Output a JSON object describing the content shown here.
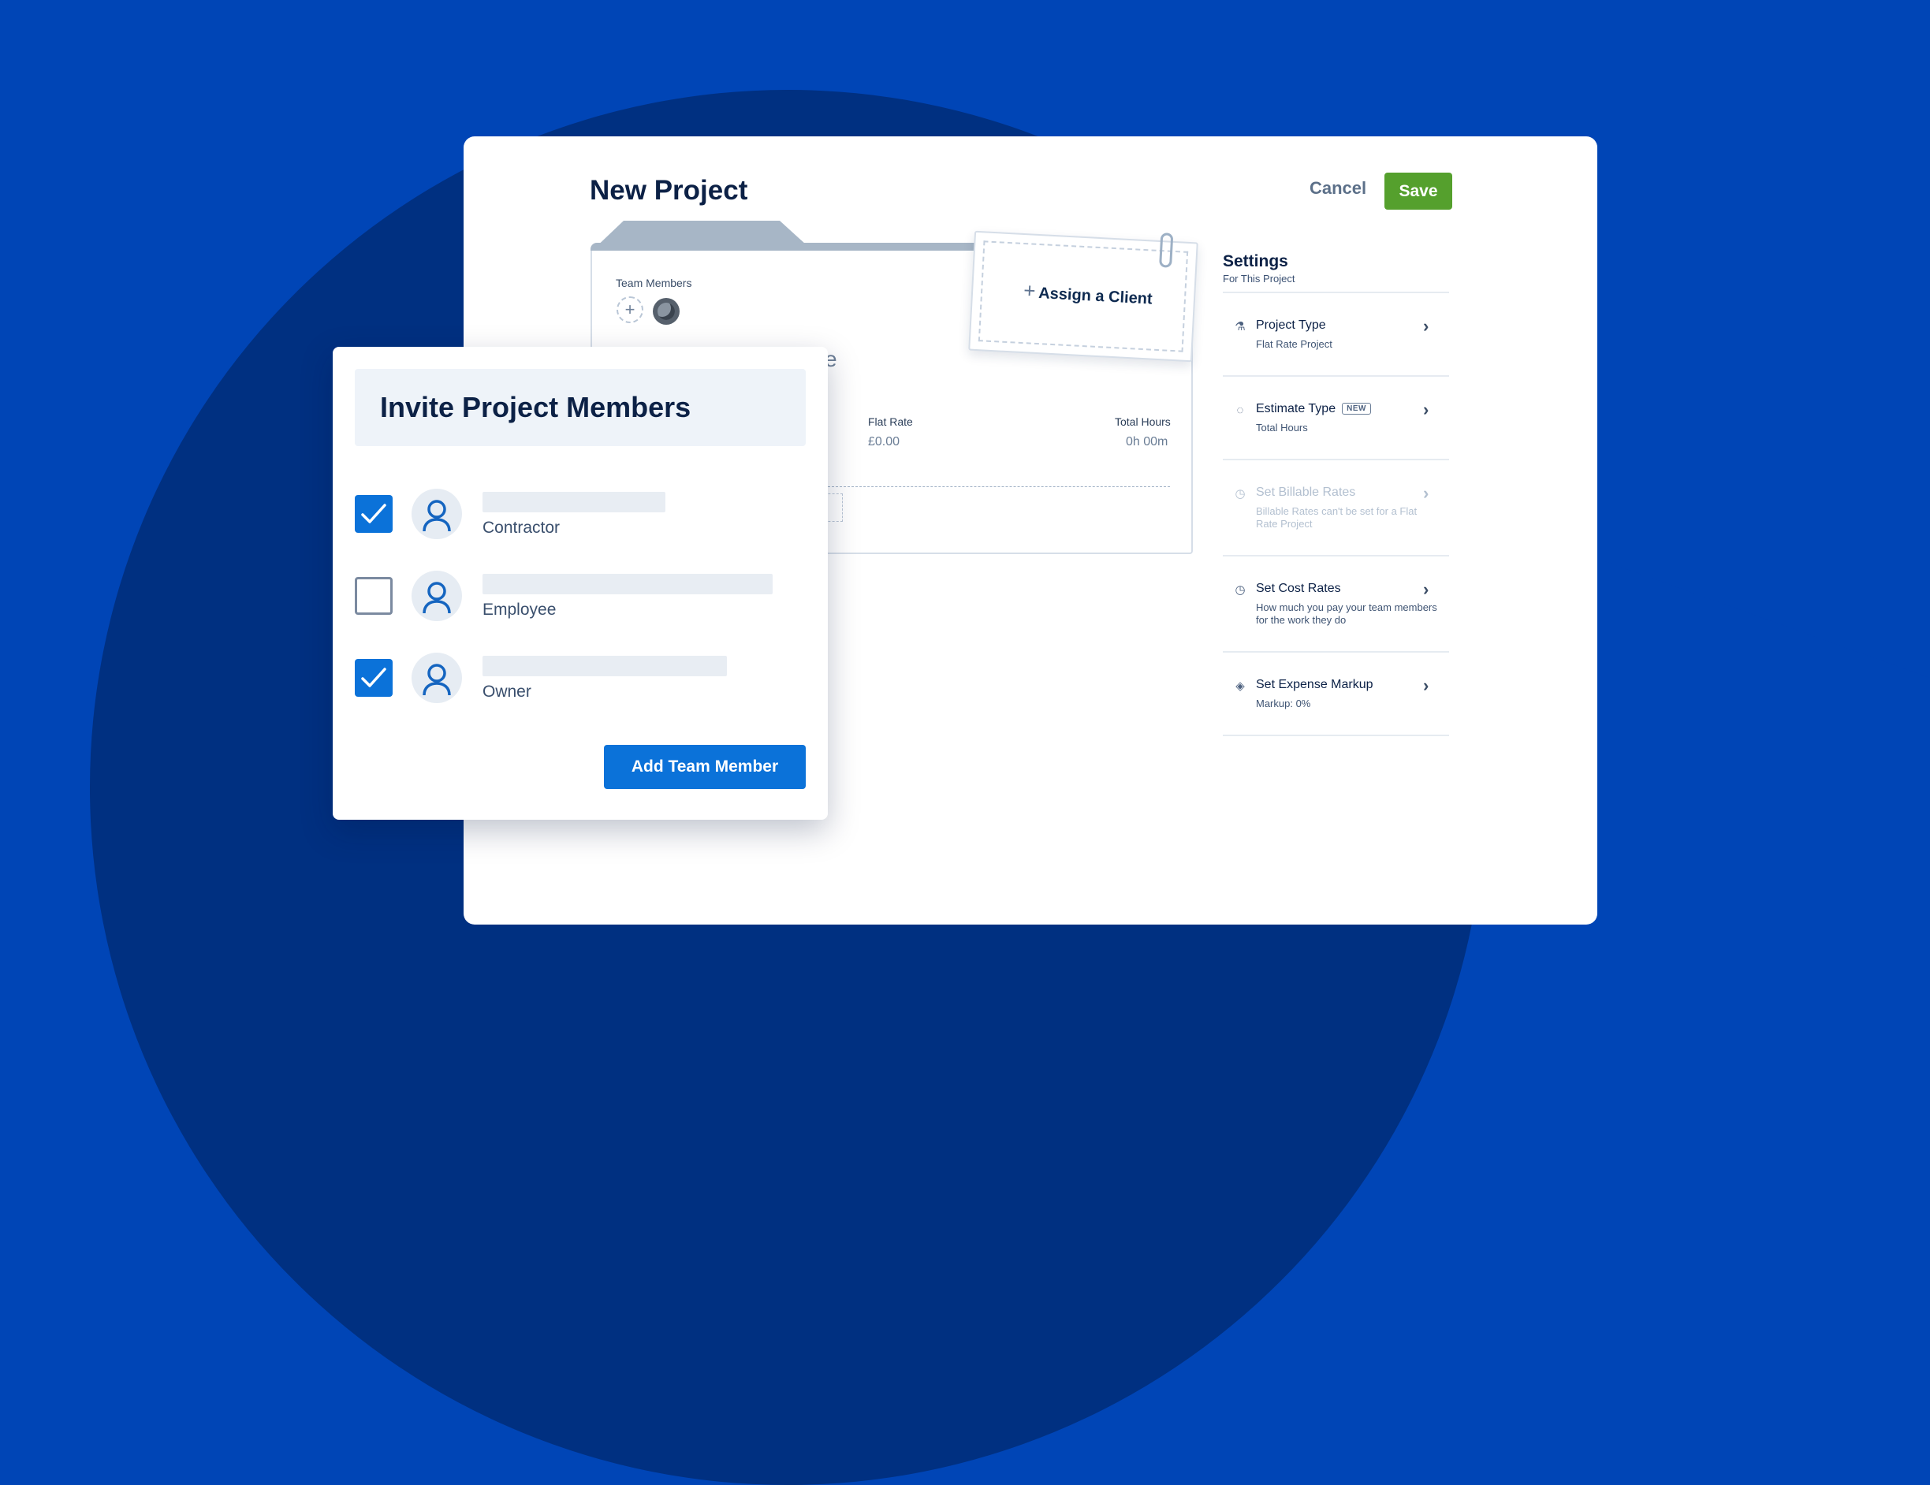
{
  "page": {
    "title": "New Project",
    "cancel_label": "Cancel",
    "save_label": "Save"
  },
  "project": {
    "team_members_label": "Team Members",
    "team_add_icon": "plus-icon",
    "name_fragment": "e",
    "flat_rate_label": "Flat Rate",
    "flat_rate_value": "£0.00",
    "total_hours_label": "Total Hours",
    "total_hours_value": "0h 00m",
    "assign_client_label": "Assign a Client",
    "assign_client_icon": "plus-icon"
  },
  "settings": {
    "title": "Settings",
    "subtitle": "For This Project",
    "items": [
      {
        "title": "Project Type",
        "desc": "Flat Rate Project",
        "icon": "flask-icon",
        "badge": "",
        "disabled": false
      },
      {
        "title": "Estimate Type",
        "desc": "Total Hours",
        "icon": "lightbulb-icon",
        "badge": "NEW",
        "disabled": false
      },
      {
        "title": "Set Billable Rates",
        "desc": "Billable Rates can't be set for a Flat Rate Project",
        "icon": "clock-icon",
        "badge": "",
        "disabled": true
      },
      {
        "title": "Set Cost Rates",
        "desc": "How much you pay your team members for the work they do",
        "icon": "stopwatch-icon",
        "badge": "",
        "disabled": false
      },
      {
        "title": "Set Expense Markup",
        "desc": "Markup: 0%",
        "icon": "diamond-icon",
        "badge": "",
        "disabled": false
      }
    ]
  },
  "invite": {
    "title": "Invite Project Members",
    "members": [
      {
        "role": "Contractor",
        "checked": true
      },
      {
        "role": "Employee",
        "checked": false
      },
      {
        "role": "Owner",
        "checked": true
      }
    ],
    "add_button_label": "Add Team Member"
  },
  "colors": {
    "background": "#0045B6",
    "background_dark": "#003081",
    "save_green": "#55a02d",
    "primary_blue": "#0b72d9"
  }
}
